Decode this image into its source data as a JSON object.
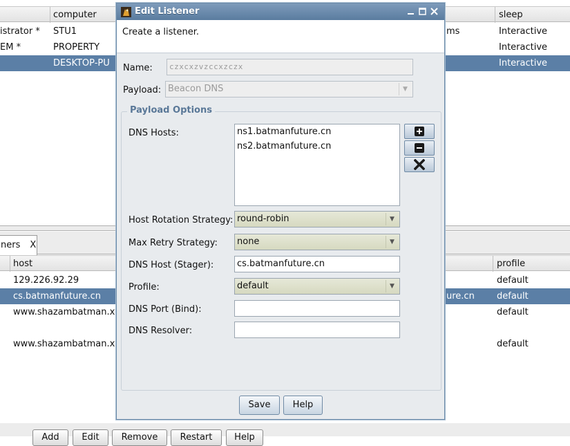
{
  "background": {
    "top_table": {
      "headers": {
        "computer": "computer",
        "sleep": "sleep"
      },
      "rows": [
        {
          "user": "istrator *",
          "computer": "STU1",
          "mid": "ms",
          "sleep": "Interactive"
        },
        {
          "user": "EM *",
          "computer": "PROPERTY",
          "mid": "",
          "sleep": "Interactive"
        },
        {
          "user": "",
          "computer": "DESKTOP-PU",
          "mid": "",
          "sleep": "Interactive"
        }
      ]
    },
    "tab": {
      "label": "ners",
      "close": "X"
    },
    "bottom_table": {
      "headers": {
        "host": "host",
        "profile": "profile"
      },
      "rows": [
        {
          "host": "129.226.92.29",
          "mid": "",
          "profile": "default"
        },
        {
          "host": "cs.batmanfuture.cn",
          "mid": "ure.cn",
          "profile": "default"
        },
        {
          "host": "www.shazambatman.xyz",
          "mid": "",
          "profile": "default"
        },
        {
          "host": "",
          "mid": "",
          "profile": ""
        },
        {
          "host": "www.shazambatman.xyz",
          "mid": "",
          "profile": "default"
        }
      ]
    },
    "bottom_buttons": [
      "Add",
      "Edit",
      "Remove",
      "Restart",
      "Help"
    ]
  },
  "dialog": {
    "title": "Edit Listener",
    "description": "Create a listener.",
    "name_label": "Name:",
    "name_value": "czxcxzvzccxzczx",
    "payload_label": "Payload:",
    "payload_value": "Beacon DNS",
    "group_title": "Payload Options",
    "dns_hosts_label": "DNS Hosts:",
    "dns_hosts": [
      "ns1.batmanfuture.cn",
      "ns2.batmanfuture.cn"
    ],
    "rotation_label": "Host Rotation Strategy:",
    "rotation_value": "round-robin",
    "retry_label": "Max Retry Strategy:",
    "retry_value": "none",
    "stager_label": "DNS Host (Stager):",
    "stager_value": "cs.batmanfuture.cn",
    "profile_label": "Profile:",
    "profile_value": "default",
    "port_label": "DNS Port (Bind):",
    "port_value": "",
    "resolver_label": "DNS Resolver:",
    "resolver_value": "",
    "save_label": "Save",
    "help_label": "Help",
    "add_icon": "plus-icon",
    "remove_icon": "minus-icon",
    "clear_icon": "x-icon"
  },
  "colors": {
    "selection": "#5b7fa6",
    "titlebar": "#5a7c9f",
    "group_title": "#5a7898"
  }
}
